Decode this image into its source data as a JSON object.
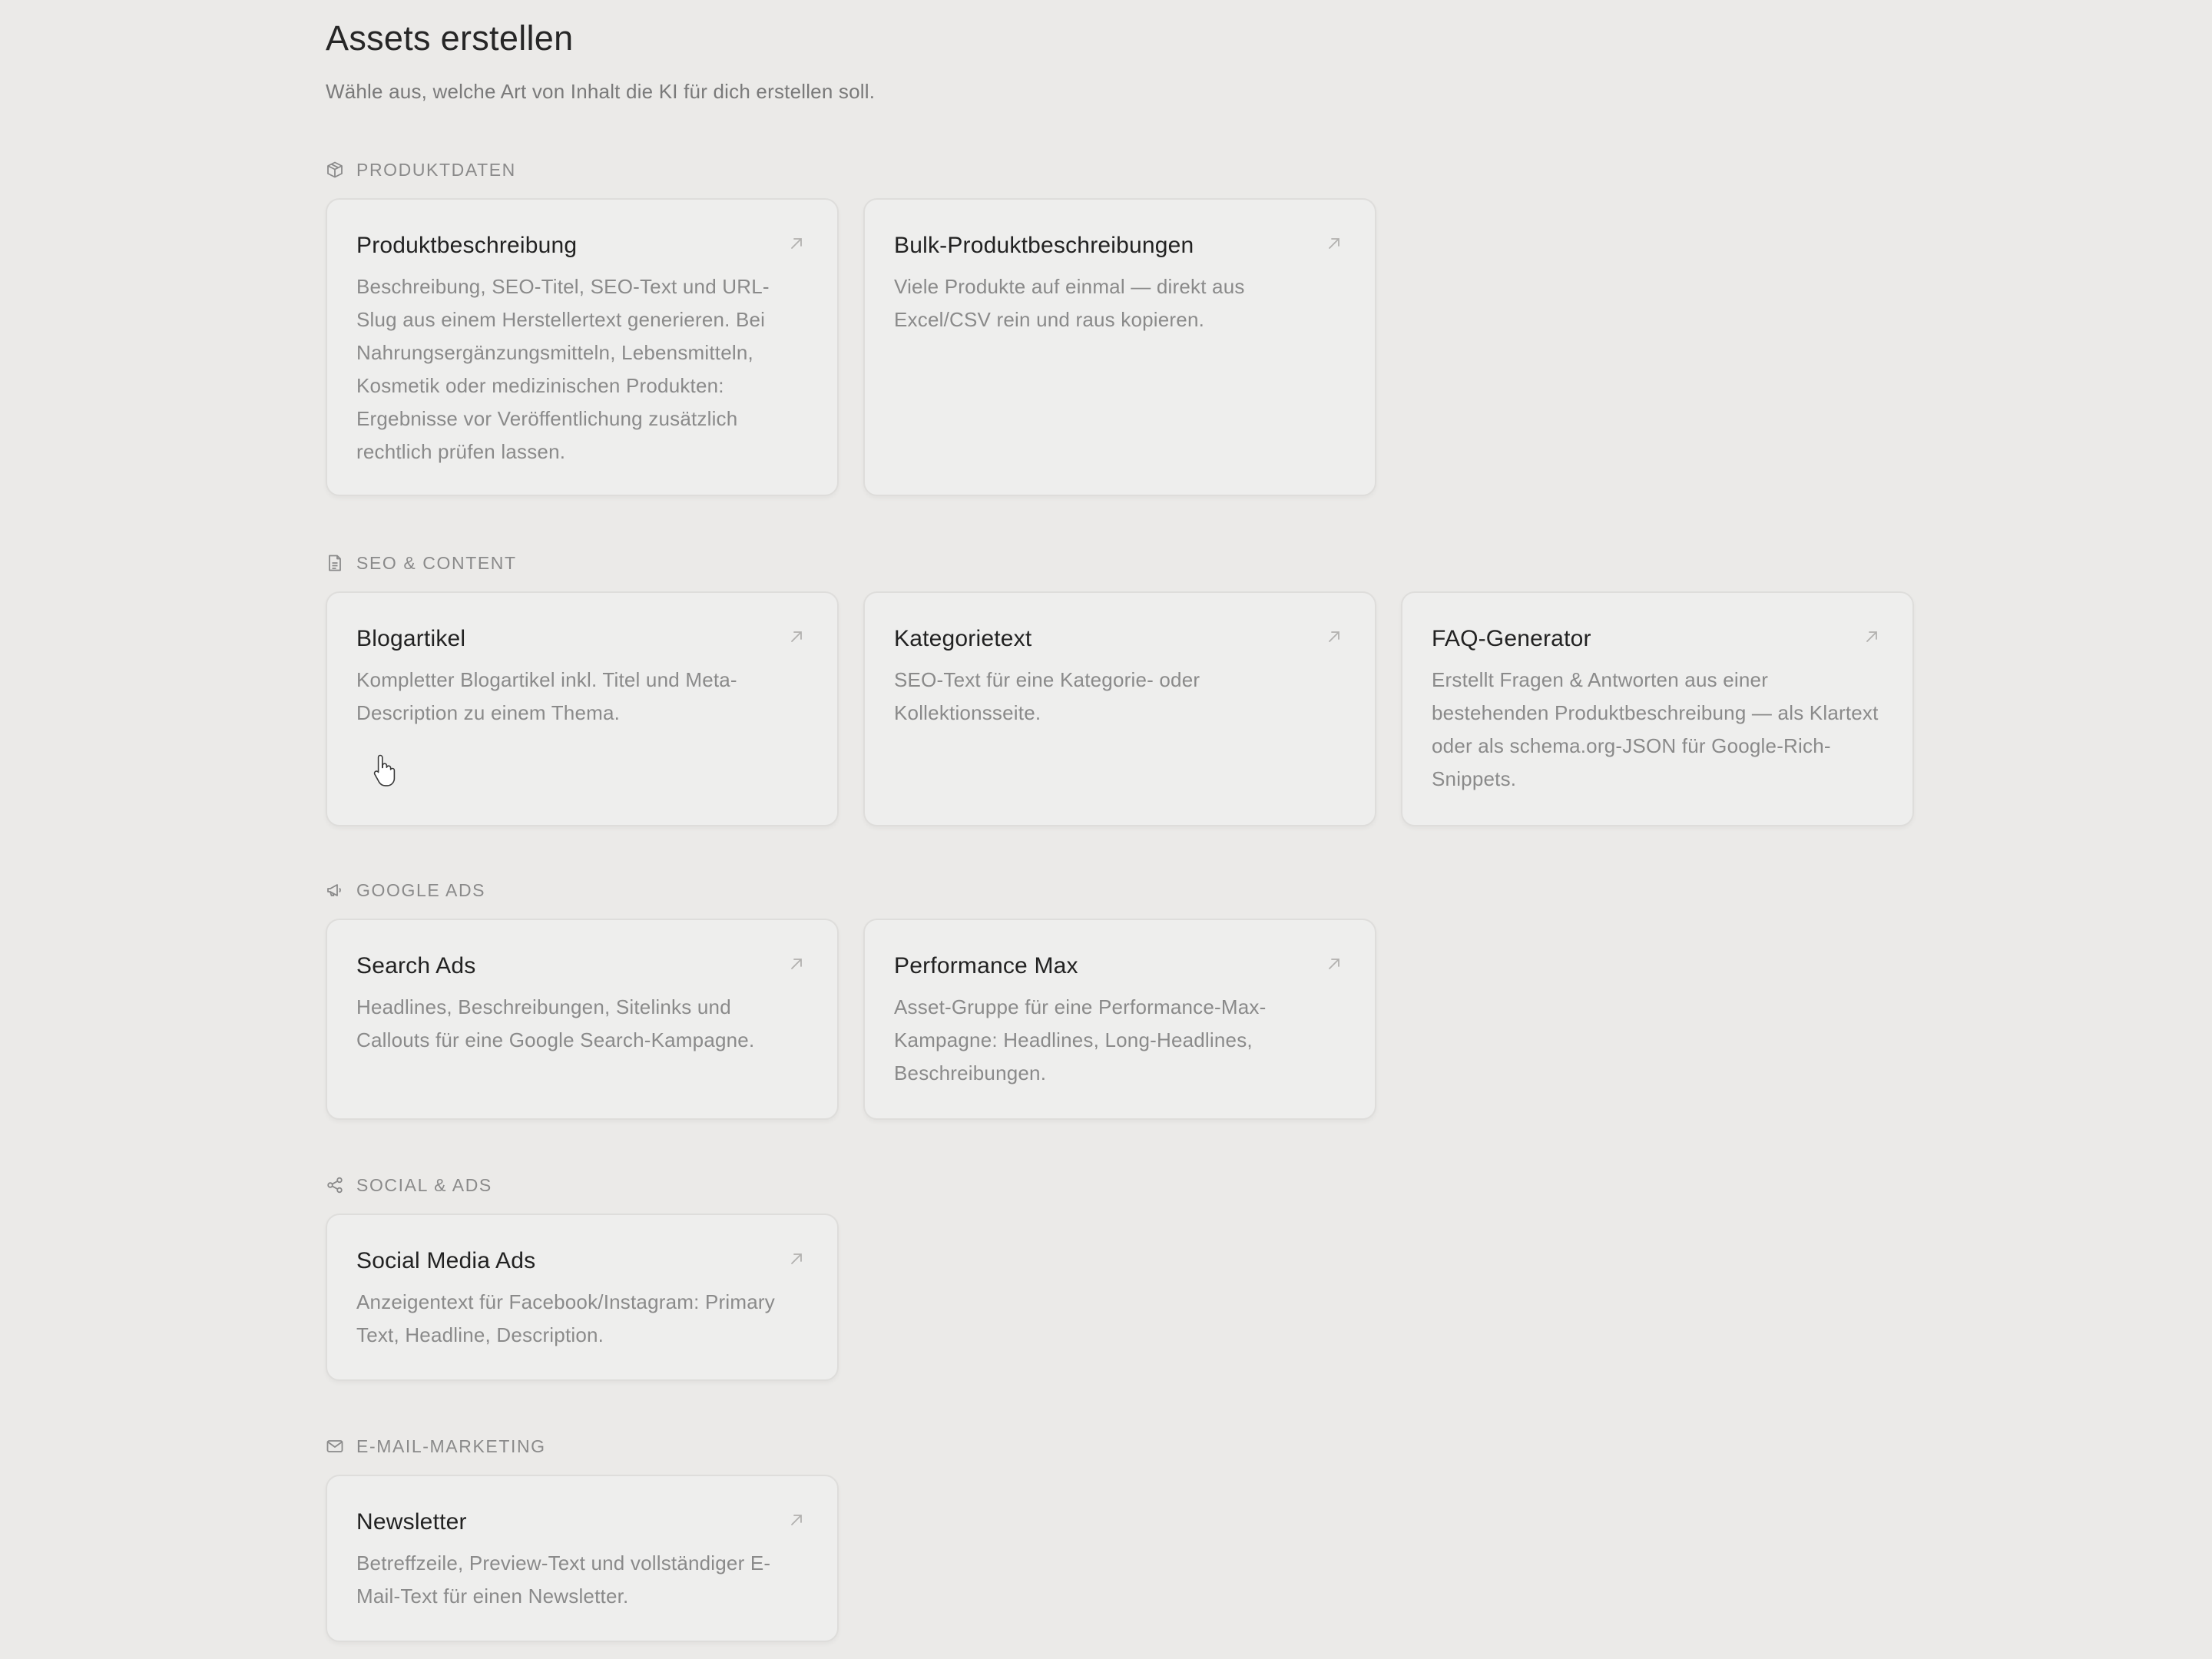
{
  "page": {
    "title": "Assets erstellen",
    "subtitle": "Wähle aus, welche Art von Inhalt die KI für dich erstellen soll."
  },
  "sections": [
    {
      "label": "PRODUKTDATEN",
      "icon": "box-icon",
      "cards": [
        {
          "title": "Produktbeschreibung",
          "description": "Beschreibung, SEO-Titel, SEO-Text und URL-Slug aus einem Herstellertext generieren. Bei Nahrungsergänzungsmitteln, Lebensmitteln, Kosmetik oder medizinischen Produkten: Ergebnisse vor Veröffentlichung zusätzlich rechtlich prüfen lassen."
        },
        {
          "title": "Bulk-Produktbeschreibungen",
          "description": "Viele Produkte auf einmal — direkt aus Excel/CSV rein und raus kopieren."
        }
      ]
    },
    {
      "label": "SEO & CONTENT",
      "icon": "document-icon",
      "cards": [
        {
          "title": "Blogartikel",
          "description": "Kompletter Blogartikel inkl. Titel und Meta-Description zu einem Thema."
        },
        {
          "title": "Kategorietext",
          "description": "SEO-Text für eine Kategorie- oder Kollektionsseite."
        },
        {
          "title": "FAQ-Generator",
          "description": "Erstellt Fragen & Antworten aus einer bestehenden Produktbeschreibung — als Klartext oder als schema.org-JSON für Google-Rich-Snippets."
        }
      ]
    },
    {
      "label": "GOOGLE ADS",
      "icon": "megaphone-icon",
      "cards": [
        {
          "title": "Search Ads",
          "description": "Headlines, Beschreibungen, Sitelinks und Callouts für eine Google Search-Kampagne."
        },
        {
          "title": "Performance Max",
          "description": "Asset-Gruppe für eine Performance-Max-Kampagne: Headlines, Long-Headlines, Beschreibungen."
        }
      ]
    },
    {
      "label": "SOCIAL & ADS",
      "icon": "share-icon",
      "cards": [
        {
          "title": "Social Media Ads",
          "description": "Anzeigentext für Facebook/Instagram: Primary Text, Headline, Description."
        }
      ]
    },
    {
      "label": "E-MAIL-MARKETING",
      "icon": "mail-icon",
      "cards": [
        {
          "title": "Newsletter",
          "description": "Betreffzeile, Preview-Text und vollständiger E-Mail-Text für einen Newsletter."
        }
      ]
    }
  ]
}
